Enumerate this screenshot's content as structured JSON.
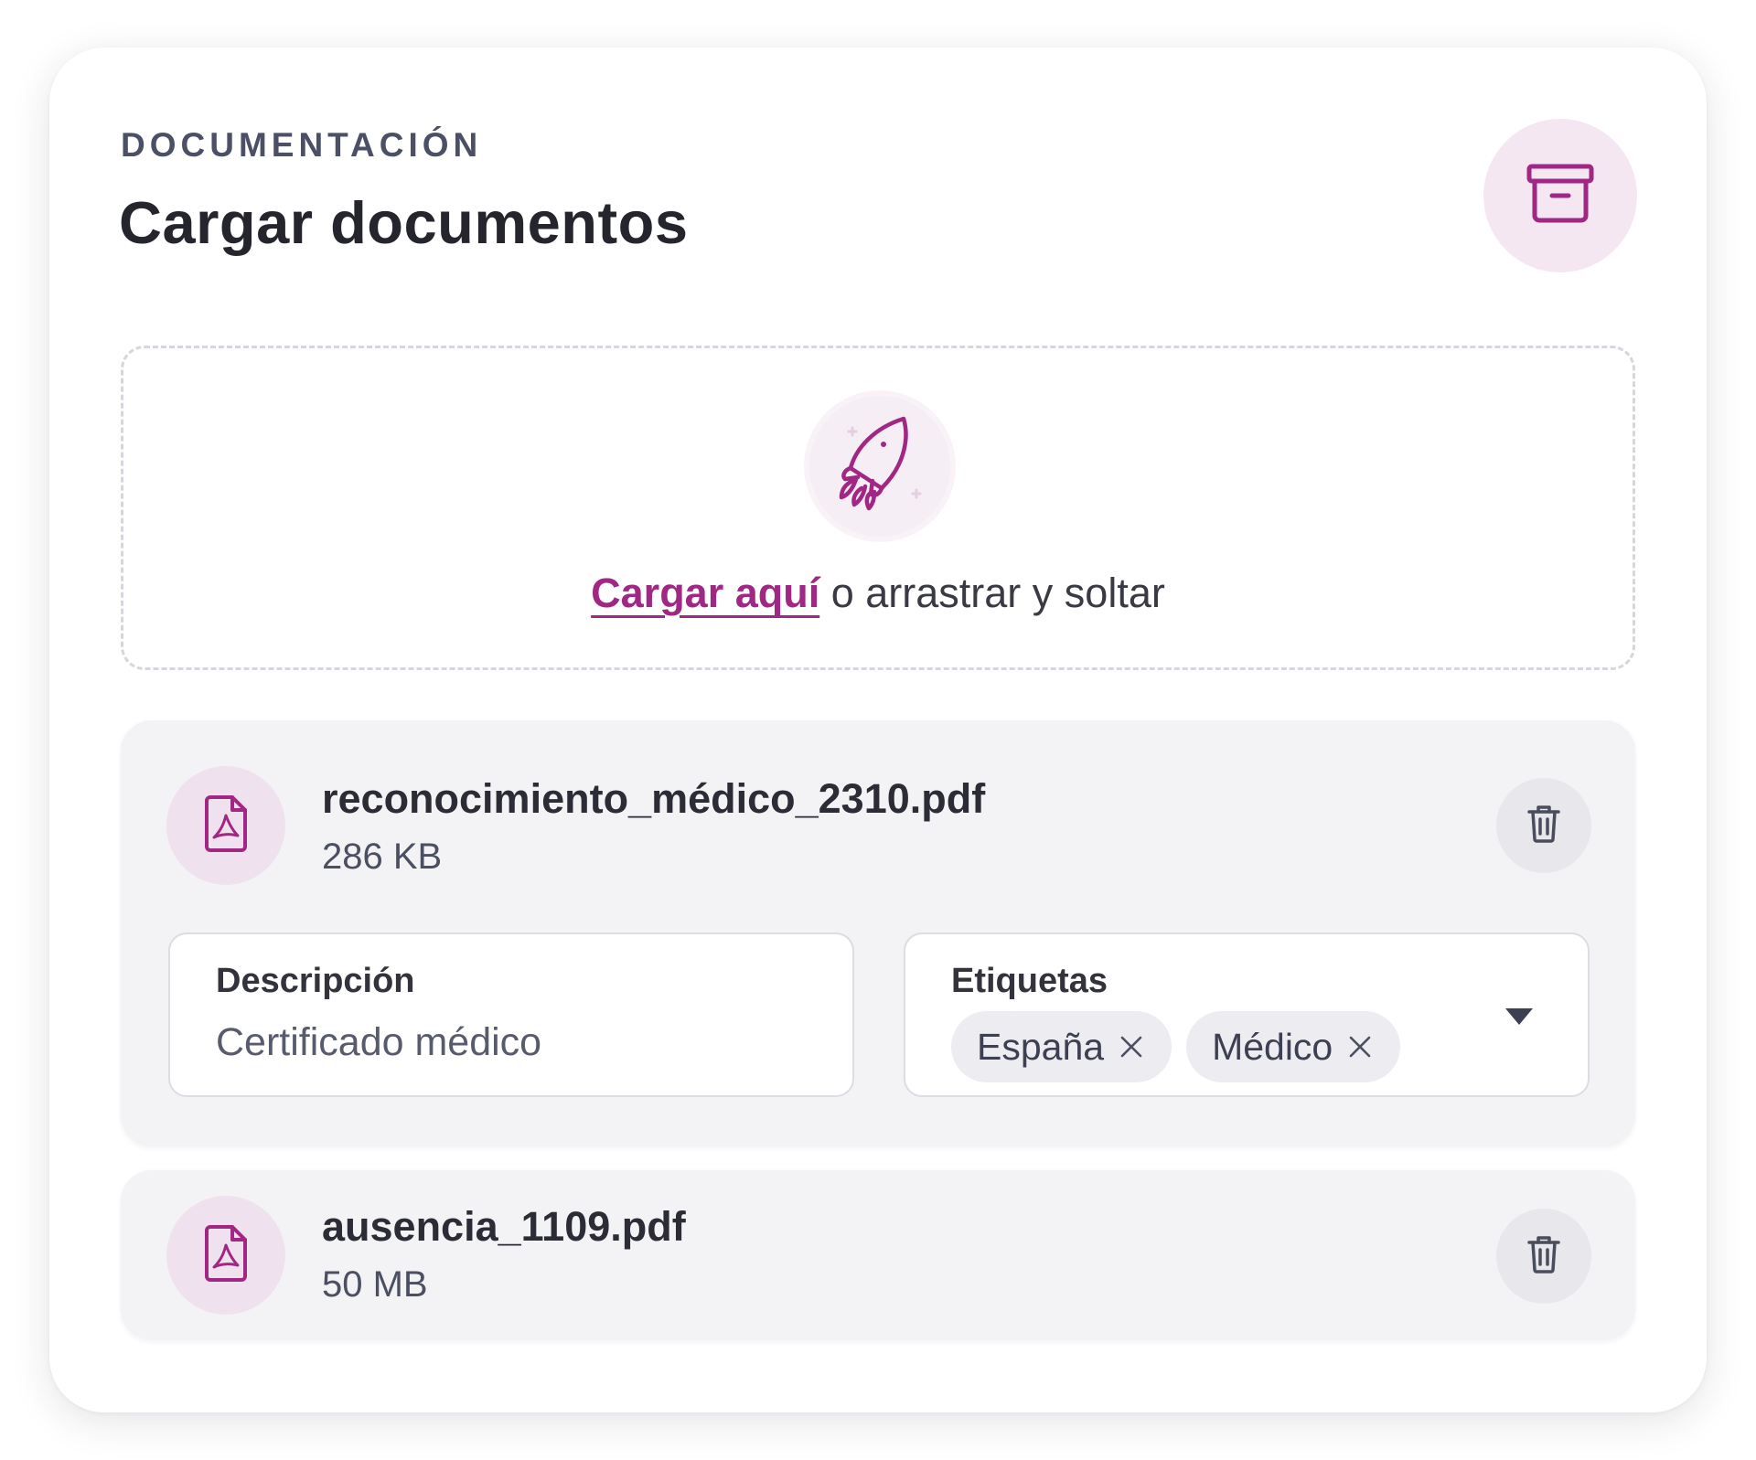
{
  "header": {
    "eyebrow": "DOCUMENTACIÓN",
    "title": "Cargar documentos",
    "archive_icon": "archive-box-icon"
  },
  "dropzone": {
    "illustration_icon": "rocket-icon",
    "link_text": "Cargar aquí",
    "rest_text": " o arrastrar y soltar"
  },
  "files": [
    {
      "name": "reconocimiento_médico_2310.pdf",
      "size": "286 KB",
      "icon": "pdf-file-icon",
      "description": {
        "label": "Descripción",
        "value": "Certificado médico"
      },
      "tags": {
        "label": "Etiquetas",
        "items": [
          "España",
          "Médico"
        ]
      }
    },
    {
      "name": "ausencia_1109.pdf",
      "size": "50 MB",
      "icon": "pdf-file-icon"
    }
  ],
  "colors": {
    "accent": "#a12784",
    "accent_soft": "#f4e7f2",
    "card_bg": "#f3f3f6",
    "title": "#25252e"
  }
}
